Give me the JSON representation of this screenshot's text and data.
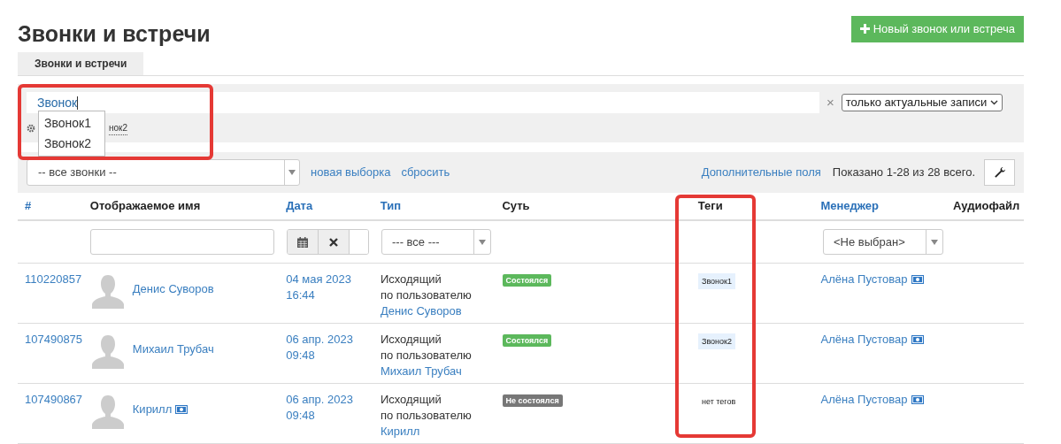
{
  "title": "Звонки и встречи",
  "new_button": "Новый звонок или встреча",
  "tabs": [
    {
      "label": "Звонки и встречи",
      "selected": true
    }
  ],
  "search": {
    "value": "Звонок",
    "suggestions": [
      "Звонок1",
      "Звонок2"
    ],
    "hidden_tag": "нок2",
    "clear": "×",
    "scope_select": "только актуальные записи"
  },
  "toolbar": {
    "select": "-- все звонки --",
    "links": [
      "новая выборка",
      "сбросить"
    ],
    "extra_fields": "Дополнительные поля",
    "count": "Показано 1-28 из 28 всего."
  },
  "table": {
    "columns": [
      {
        "label": "#",
        "sortable": true
      },
      {
        "label": "Отображаемое имя",
        "sortable": false
      },
      {
        "label": "Дата",
        "sortable": true
      },
      {
        "label": "Тип",
        "sortable": true
      },
      {
        "label": "Суть",
        "sortable": false
      },
      {
        "label": "Теги",
        "sortable": false
      },
      {
        "label": "Менеджер",
        "sortable": true
      },
      {
        "label": "Аудиофайл",
        "sortable": false
      }
    ],
    "type_filter": "--- все ---",
    "manager_filter": "<Не выбран>",
    "rows": [
      {
        "id": "110220857",
        "name": "Денис Суворов",
        "name_icon": false,
        "date": "04 мая 2023",
        "time": "16:44",
        "direction": "Исходящий",
        "via": "по пользователю",
        "user": "Денис Суворов",
        "status": {
          "label": "Состоялся",
          "kind": "success"
        },
        "tag": {
          "kind": "tag",
          "label": "Звонок1"
        },
        "manager": "Алёна Пустовар"
      },
      {
        "id": "107490875",
        "name": "Михаил Трубач",
        "name_icon": false,
        "date": "06 апр. 2023",
        "time": "09:48",
        "direction": "Исходящий",
        "via": "по пользователю",
        "user": "Михаил Трубач",
        "status": {
          "label": "Состоялся",
          "kind": "success"
        },
        "tag": {
          "kind": "tag",
          "label": "Звонок2"
        },
        "manager": "Алёна Пустовар"
      },
      {
        "id": "107490867",
        "name": "Кирилл",
        "name_icon": true,
        "date": "06 апр. 2023",
        "time": "09:48",
        "direction": "Исходящий",
        "via": "по пользователю",
        "user": "Кирилл",
        "status": {
          "label": "Не состоялся",
          "kind": "fail"
        },
        "tag": {
          "kind": "empty",
          "label": "нет тегов"
        },
        "manager": "Алёна Пустовар"
      }
    ]
  }
}
